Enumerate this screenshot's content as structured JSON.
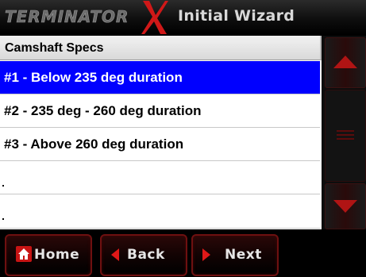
{
  "header": {
    "logo_text": "TERMINATOR",
    "title": "Initial Wizard"
  },
  "list": {
    "heading": "Camshaft Specs",
    "rows": [
      {
        "label": "#1 - Below 235 deg duration",
        "selected": true
      },
      {
        "label": "#2 - 235 deg - 260 deg duration",
        "selected": false
      },
      {
        "label": "#3 - Above 260 deg duration",
        "selected": false
      },
      {
        "label": "",
        "selected": false
      },
      {
        "label": "",
        "selected": false
      }
    ]
  },
  "scrollbar": {
    "up_icon": "triangle-up-icon",
    "thumb_icon": "grip-lines-icon",
    "down_icon": "triangle-down-icon"
  },
  "footer": {
    "home_label": "Home",
    "back_label": "Back",
    "next_label": "Next",
    "home_icon": "house-icon",
    "back_icon": "triangle-left-icon",
    "next_icon": "triangle-right-icon"
  },
  "colors": {
    "selection": "#0000ff",
    "accent_red": "#c81414",
    "background": "#000000"
  }
}
